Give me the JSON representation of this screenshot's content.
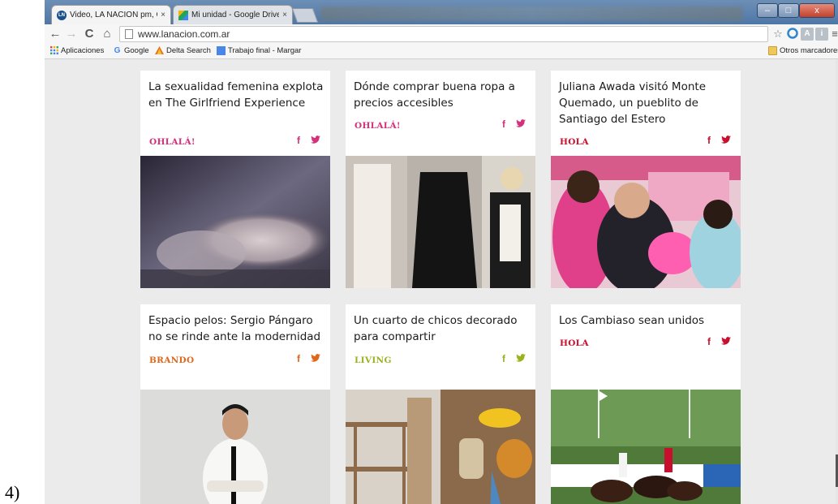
{
  "figure_label": "4)",
  "browser": {
    "tabs": [
      {
        "title": "Video, LA NACION pm, C",
        "close": "×"
      },
      {
        "title": "Mi unidad - Google Drive",
        "close": "×"
      }
    ],
    "window_controls": {
      "minimize": "–",
      "maximize": "□",
      "close": "x"
    },
    "nav": {
      "back": "←",
      "forward": "→",
      "reload": "C",
      "home": "⌂"
    },
    "url": "www.lanacion.com.ar",
    "toolbar_icons": {
      "star": "☆",
      "extension_a": "A",
      "extension_i": "i",
      "menu": "≡"
    }
  },
  "bookmarks": {
    "apps": "Aplicaciones",
    "items": [
      "Google",
      "Delta Search",
      "Trabajo final - Margar"
    ],
    "other": "Otros marcadores"
  },
  "cards": [
    {
      "title": "La sexualidad femenina explota en The Girlfriend Experience",
      "section": "OHLALÁ!",
      "color": "#d4317b"
    },
    {
      "title": "Dónde comprar buena ropa a precios accesibles",
      "section": "OHLALÁ!",
      "color": "#d4317b"
    },
    {
      "title": "Juliana Awada visitó Monte Quemado, un pueblito de Santiago del Estero",
      "section": "HOLA",
      "color": "#c8102e"
    },
    {
      "title": "Espacio pelos: Sergio Pángaro no se rinde ante la modernidad",
      "section": "BRANDO",
      "color": "#e0661a"
    },
    {
      "title": "Un cuarto de chicos decorado para compartir",
      "section": "LIVING",
      "color": "#9bb21c"
    },
    {
      "title": "Los Cambiaso sean unidos",
      "section": "HOLA",
      "color": "#c8102e"
    }
  ],
  "social": {
    "facebook": "f",
    "twitter": "🐦"
  },
  "colors": {
    "titlebar": "#5a7fae",
    "page_bg": "#ebebeb",
    "card_bg": "#ffffff"
  }
}
